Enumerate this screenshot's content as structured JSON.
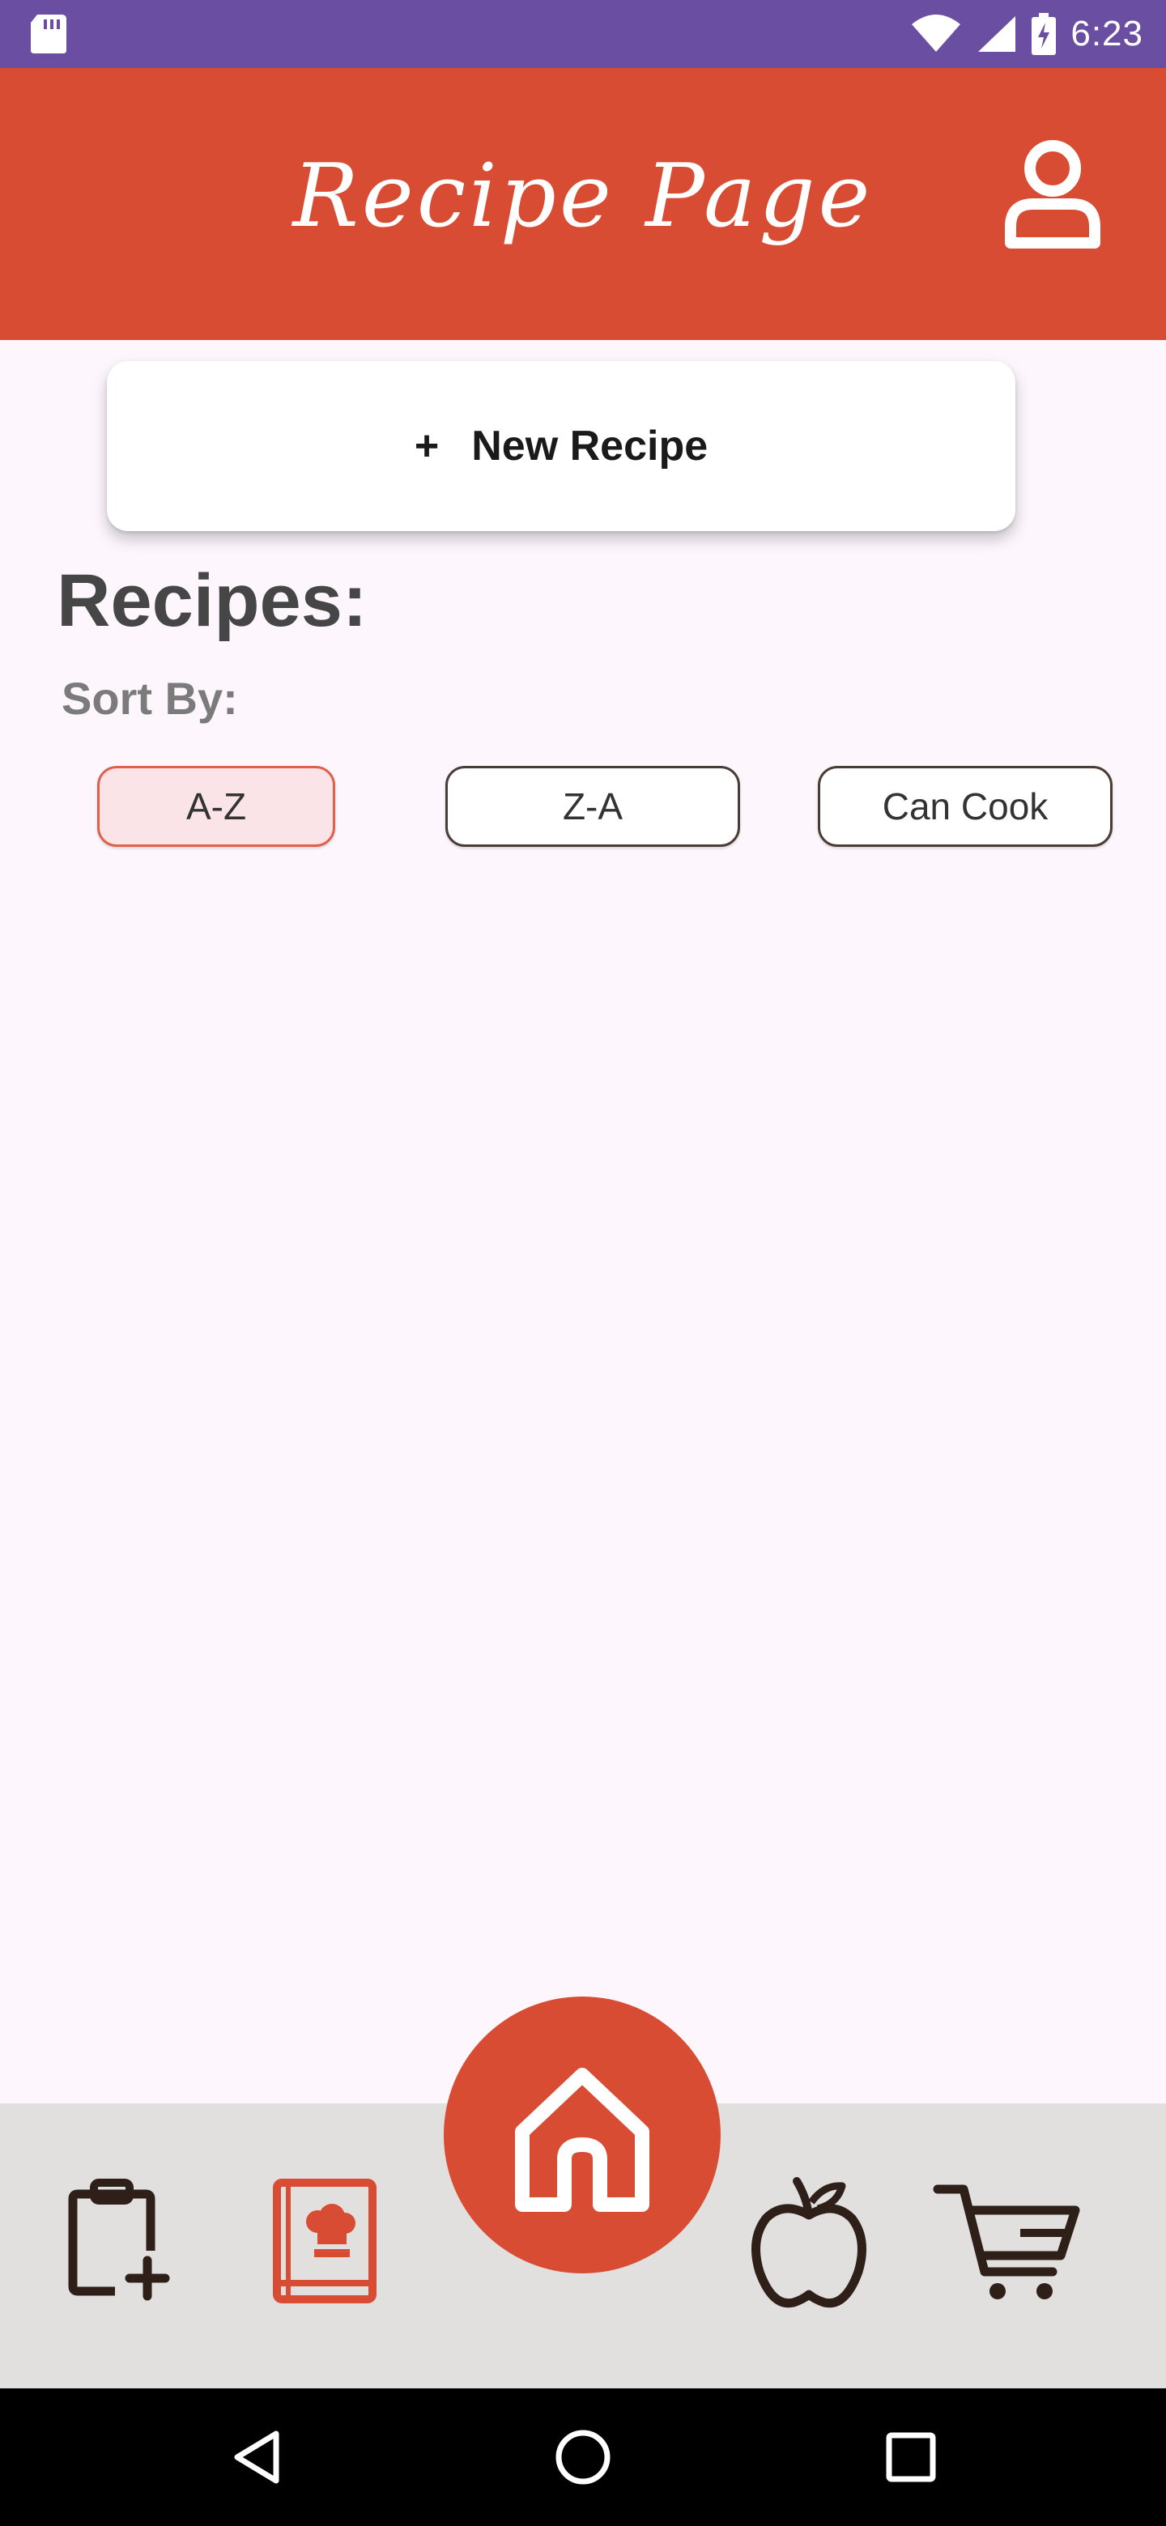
{
  "status_bar": {
    "time": "6:23",
    "icons": [
      "sd-card-icon",
      "wifi-icon",
      "cell-signal-icon",
      "battery-charging-icon"
    ]
  },
  "header": {
    "title": "Recipe Page",
    "profile_icon": "person-icon"
  },
  "new_recipe": {
    "plus": "+",
    "label": "New Recipe"
  },
  "recipes": {
    "heading": "Recipes:",
    "sort_label": "Sort By:",
    "sort_options": [
      {
        "label": "A-Z",
        "active": true
      },
      {
        "label": "Z-A",
        "active": false
      },
      {
        "label": "Can Cook",
        "active": false
      }
    ]
  },
  "bottom_nav": {
    "items": [
      {
        "icon": "clipboard-plus-icon",
        "active": false
      },
      {
        "icon": "cookbook-icon",
        "active": true
      },
      {
        "icon": "home-icon",
        "active": false
      },
      {
        "icon": "apple-icon",
        "active": false
      },
      {
        "icon": "shopping-cart-icon",
        "active": false
      }
    ]
  },
  "system_nav": {
    "icons": [
      "back-icon",
      "home-circle-icon",
      "recents-icon"
    ]
  },
  "colors": {
    "status_bar": "#6a4ea2",
    "header": "#d84c33",
    "background": "#fdf7fd",
    "active_accent": "#e0604c",
    "icon_dark": "#2e2019",
    "nav_bg": "#e2dfdf"
  }
}
